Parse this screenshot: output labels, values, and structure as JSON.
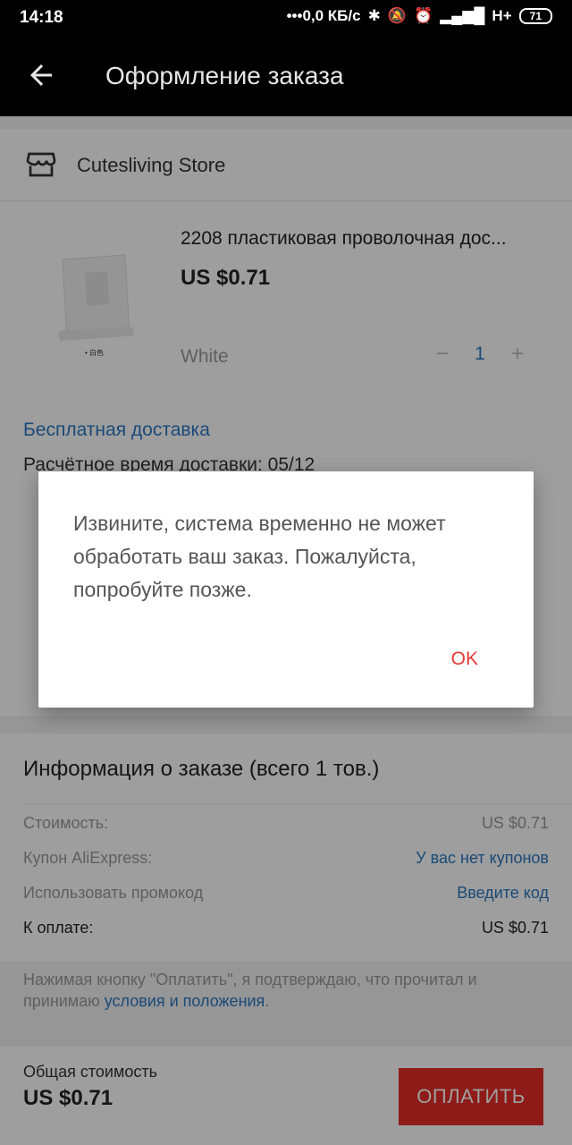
{
  "status_bar": {
    "time": "14:18",
    "indicators": "•••0,0 КБ/с",
    "network": "H+",
    "battery": "71"
  },
  "app_bar": {
    "title": "Оформление заказа",
    "back_icon": "arrow-left-icon"
  },
  "store": {
    "name": "Cutesliving Store",
    "icon": "store-icon"
  },
  "product": {
    "name": "2208 пластиковая проволочная дос...",
    "price": "US $0.71",
    "variant": "White",
    "quantity": "1",
    "minus": "−",
    "plus": "+",
    "thumb_caption": "• 白色"
  },
  "shipping": {
    "method": "Бесплатная доставка",
    "eta_label": "Расчётное время доставки: 05/12"
  },
  "order_info": {
    "heading": "Информация о заказе (всего 1 тов.)",
    "rows": [
      {
        "label": "Стоимость:",
        "value": "US $0.71"
      },
      {
        "label": "Купон AliExpress:",
        "value": "У вас нет купонов"
      },
      {
        "label": "Использовать промокод",
        "value": "Введите код"
      },
      {
        "label": "К оплате:",
        "value": "US $0.71"
      }
    ]
  },
  "terms": {
    "text": "Нажимая кнопку \"Оплатить\", я подтверждаю, что прочитал и принимаю ",
    "link": "условия и положения",
    "end": "."
  },
  "footer": {
    "total_label": "Общая стоимость",
    "total_value": "US $0.71",
    "pay_button": "ОПЛАТИТЬ"
  },
  "dialog": {
    "message": "Извините, система временно не может обработать ваш заказ. Пожалуйста, попробуйте позже.",
    "ok": "OK"
  },
  "colors": {
    "accent": "#e52d27",
    "link": "#2b78c2",
    "ok": "#e53935"
  }
}
